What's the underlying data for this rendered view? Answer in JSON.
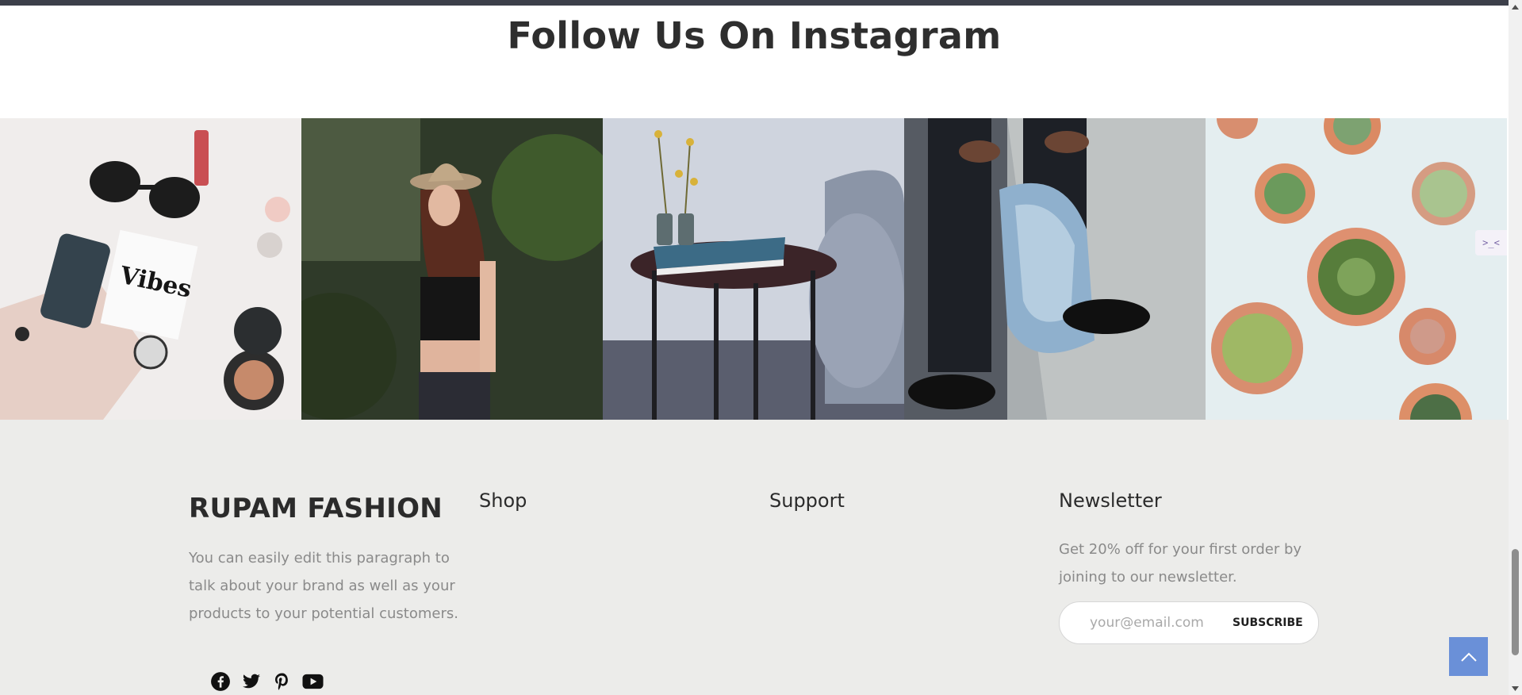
{
  "instagram": {
    "title": "Follow Us On Instagram",
    "photos": [
      "flatlay-accessories",
      "woman-in-hat",
      "side-table-with-book",
      "jeans-and-sneakers",
      "potted-succulents"
    ]
  },
  "side_widget": {
    "text": ">_<"
  },
  "footer": {
    "brand": "RUPAM FASHION",
    "brand_text": "You can easily edit this paragraph to talk about your brand as well as your products to your potential customers.",
    "social_icons": [
      "facebook-icon",
      "twitter-icon",
      "pinterest-icon",
      "youtube-icon"
    ],
    "shop_title": "Shop",
    "support_title": "Support",
    "newsletter_title": "Newsletter",
    "newsletter_text": "Get 20% off for your first order by joining to our newsletter.",
    "email_placeholder": "your@email.com",
    "subscribe_label": "SUBSCRIBE"
  },
  "colors": {
    "accent": "#6a90d8",
    "footer_bg": "#ececea",
    "topbar": "#3c3f4a"
  }
}
